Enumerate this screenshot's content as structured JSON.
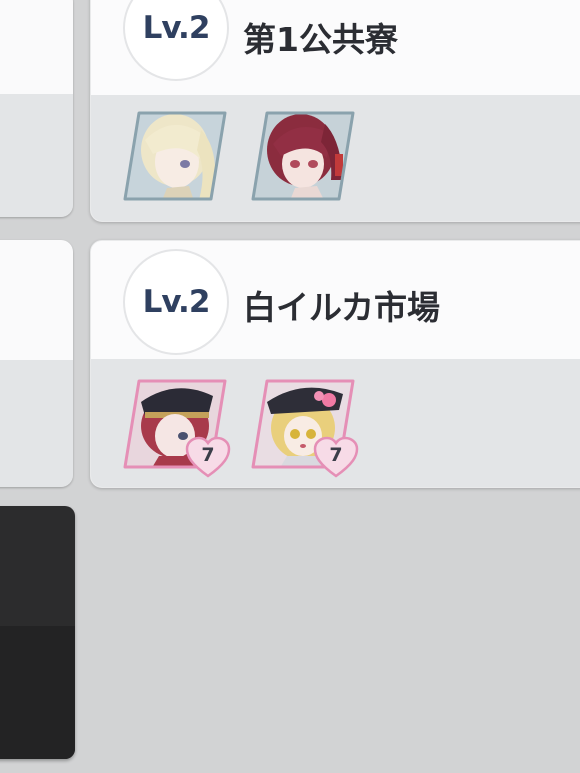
{
  "facilities": [
    {
      "level": "Lv.2",
      "name": "第1公共寮",
      "characters": [
        {
          "icon": "blonde-girl-portrait"
        },
        {
          "icon": "red-hair-girl-portrait"
        }
      ]
    },
    {
      "level": "Lv.2",
      "name": "白イルカ市場",
      "characters": [
        {
          "icon": "red-hair-cap-girl-portrait",
          "bond": "7"
        },
        {
          "icon": "blonde-cap-girl-portrait",
          "bond": "7"
        }
      ]
    }
  ]
}
